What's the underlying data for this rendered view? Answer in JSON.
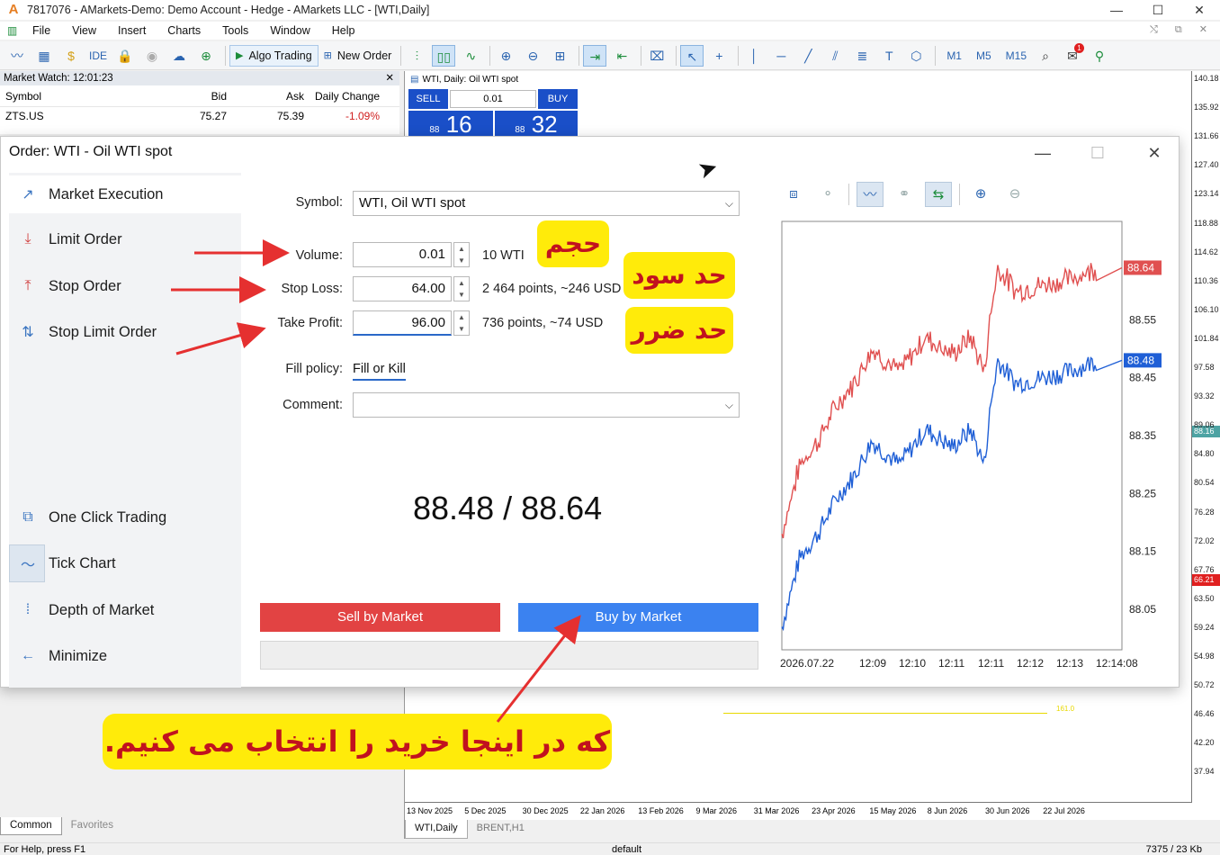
{
  "window": {
    "title": "7817076 - AMarkets-Demo: Demo Account - Hedge - AMarkets LLC - [WTI,Daily]",
    "logo_letter": "A",
    "minimize": "—",
    "maximize": "☐",
    "close": "✕"
  },
  "menu": [
    "File",
    "View",
    "Insert",
    "Charts",
    "Tools",
    "Window",
    "Help"
  ],
  "toolbar": {
    "ide_label": "IDE",
    "algo_label": "Algo Trading",
    "new_order_label": "New Order",
    "timeframes": [
      "M1",
      "M5",
      "M15"
    ],
    "notification_count": "1"
  },
  "market_watch": {
    "title": "Market Watch: 12:01:23",
    "close": "✕",
    "columns": [
      "Symbol",
      "Bid",
      "Ask",
      "Daily Change"
    ],
    "rows": [
      {
        "symbol": "ZTS.US",
        "bid": "75.27",
        "ask": "75.39",
        "change": "-1.09%"
      }
    ]
  },
  "chart_window": {
    "title": "WTI, Daily:  Oil WTI spot",
    "sell_label": "SELL",
    "buy_label": "BUY",
    "volume": "0.01",
    "sell_price_big": "16",
    "buy_price_big": "32",
    "sell_price_small": "88",
    "buy_price_small": "88",
    "y_ticks": [
      "140.18",
      "135.92",
      "131.66",
      "127.40",
      "123.14",
      "118.88",
      "114.62",
      "110.36",
      "106.10",
      "101.84",
      "97.58",
      "93.32",
      "89.06",
      "84.80",
      "80.54",
      "76.28",
      "72.02",
      "67.76",
      "63.50",
      "59.24",
      "54.98",
      "50.72",
      "46.46",
      "42.20",
      "37.94"
    ],
    "bid_tag": "88.16",
    "red_tag": "66.21",
    "yellow_label": "161.0",
    "x_ticks": [
      "13 Nov 2025",
      "5 Dec 2025",
      "30 Dec 2025",
      "22 Jan 2026",
      "13 Feb 2026",
      "9 Mar 2026",
      "31 Mar 2026",
      "23 Apr 2026",
      "15 May 2026",
      "8 Jun 2026",
      "30 Jun 2026",
      "22 Jul 2026"
    ],
    "tabs": [
      "WTI,Daily",
      "BRENT,H1"
    ]
  },
  "bottom_tabs": [
    "Common",
    "Favorites"
  ],
  "status": {
    "help": "For Help, press F1",
    "profile": "default",
    "traffic": "7375 / 23 Kb"
  },
  "order": {
    "title": "Order: WTI - Oil WTI spot",
    "sidebar": [
      {
        "label": "Market Execution",
        "icon": "market-execution-icon"
      },
      {
        "label": "Limit Order",
        "icon": "limit-order-icon"
      },
      {
        "label": "Stop Order",
        "icon": "stop-order-icon"
      },
      {
        "label": "Stop Limit Order",
        "icon": "stop-limit-icon"
      },
      {
        "label": "One Click Trading",
        "icon": "one-click-icon"
      },
      {
        "label": "Tick Chart",
        "icon": "tick-chart-icon"
      },
      {
        "label": "Depth of Market",
        "icon": "depth-market-icon"
      },
      {
        "label": "Minimize",
        "icon": "minimize-arrow-icon"
      }
    ],
    "symbol_label": "Symbol:",
    "symbol_value": "WTI, Oil WTI spot",
    "volume_label": "Volume:",
    "volume_value": "0.01",
    "volume_note": "10 WTI",
    "sl_label": "Stop Loss:",
    "sl_value": "64.00",
    "sl_note": "2 464 points, ~246 USD",
    "tp_label": "Take Profit:",
    "tp_value": "96.00",
    "tp_note": "736 points, ~74 USD",
    "fill_label": "Fill policy:",
    "fill_value": "Fill or Kill",
    "comment_label": "Comment:",
    "comment_value": "",
    "prices": "88.48 / 88.64",
    "sell_button": "Sell by Market",
    "buy_button": "Buy by Market"
  },
  "tick_chart": {
    "y_ticks": [
      "88.55",
      "88.45",
      "88.35",
      "88.25",
      "88.15",
      "88.05"
    ],
    "ask_tag": "88.64",
    "bid_tag": "88.48",
    "x_ticks": [
      "2026.07.22",
      "12:09",
      "12:10",
      "12:11",
      "12:11",
      "12:12",
      "12:13",
      "12:14:08"
    ],
    "colors": {
      "ask": "#e05050",
      "bid": "#1f5fd6"
    }
  },
  "annotations": {
    "volume": "حجم",
    "stop_loss": "حد سود",
    "take_profit": "حد ضرر",
    "buy_hint": "که در اینجا خرید را انتخاب می کنیم.",
    "color": "#ffeb0a",
    "text_color": "#c1121f"
  }
}
